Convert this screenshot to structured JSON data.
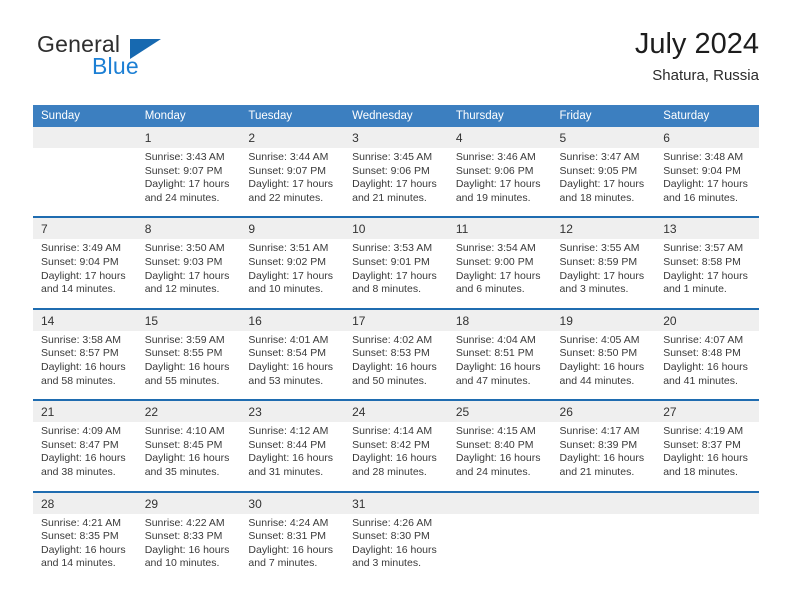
{
  "brand": {
    "name_part1": "General",
    "name_part2": "Blue",
    "triangle_color": "#1769b0",
    "blue_color": "#1c7fd4"
  },
  "header": {
    "title": "July 2024",
    "subtitle": "Shatura, Russia"
  },
  "theme": {
    "header_blue": "#3c7fc0",
    "row_divider_blue": "#1f6cb0",
    "daynum_band": "#efefef",
    "text": "#3a3a3a"
  },
  "weekdays": [
    "Sunday",
    "Monday",
    "Tuesday",
    "Wednesday",
    "Thursday",
    "Friday",
    "Saturday"
  ],
  "weeks": [
    {
      "days": [
        {
          "num": "",
          "sunrise": "",
          "sunset": "",
          "daylight1": "",
          "daylight2": ""
        },
        {
          "num": "1",
          "sunrise": "Sunrise: 3:43 AM",
          "sunset": "Sunset: 9:07 PM",
          "daylight1": "Daylight: 17 hours",
          "daylight2": "and 24 minutes."
        },
        {
          "num": "2",
          "sunrise": "Sunrise: 3:44 AM",
          "sunset": "Sunset: 9:07 PM",
          "daylight1": "Daylight: 17 hours",
          "daylight2": "and 22 minutes."
        },
        {
          "num": "3",
          "sunrise": "Sunrise: 3:45 AM",
          "sunset": "Sunset: 9:06 PM",
          "daylight1": "Daylight: 17 hours",
          "daylight2": "and 21 minutes."
        },
        {
          "num": "4",
          "sunrise": "Sunrise: 3:46 AM",
          "sunset": "Sunset: 9:06 PM",
          "daylight1": "Daylight: 17 hours",
          "daylight2": "and 19 minutes."
        },
        {
          "num": "5",
          "sunrise": "Sunrise: 3:47 AM",
          "sunset": "Sunset: 9:05 PM",
          "daylight1": "Daylight: 17 hours",
          "daylight2": "and 18 minutes."
        },
        {
          "num": "6",
          "sunrise": "Sunrise: 3:48 AM",
          "sunset": "Sunset: 9:04 PM",
          "daylight1": "Daylight: 17 hours",
          "daylight2": "and 16 minutes."
        }
      ]
    },
    {
      "days": [
        {
          "num": "7",
          "sunrise": "Sunrise: 3:49 AM",
          "sunset": "Sunset: 9:04 PM",
          "daylight1": "Daylight: 17 hours",
          "daylight2": "and 14 minutes."
        },
        {
          "num": "8",
          "sunrise": "Sunrise: 3:50 AM",
          "sunset": "Sunset: 9:03 PM",
          "daylight1": "Daylight: 17 hours",
          "daylight2": "and 12 minutes."
        },
        {
          "num": "9",
          "sunrise": "Sunrise: 3:51 AM",
          "sunset": "Sunset: 9:02 PM",
          "daylight1": "Daylight: 17 hours",
          "daylight2": "and 10 minutes."
        },
        {
          "num": "10",
          "sunrise": "Sunrise: 3:53 AM",
          "sunset": "Sunset: 9:01 PM",
          "daylight1": "Daylight: 17 hours",
          "daylight2": "and 8 minutes."
        },
        {
          "num": "11",
          "sunrise": "Sunrise: 3:54 AM",
          "sunset": "Sunset: 9:00 PM",
          "daylight1": "Daylight: 17 hours",
          "daylight2": "and 6 minutes."
        },
        {
          "num": "12",
          "sunrise": "Sunrise: 3:55 AM",
          "sunset": "Sunset: 8:59 PM",
          "daylight1": "Daylight: 17 hours",
          "daylight2": "and 3 minutes."
        },
        {
          "num": "13",
          "sunrise": "Sunrise: 3:57 AM",
          "sunset": "Sunset: 8:58 PM",
          "daylight1": "Daylight: 17 hours",
          "daylight2": "and 1 minute."
        }
      ]
    },
    {
      "days": [
        {
          "num": "14",
          "sunrise": "Sunrise: 3:58 AM",
          "sunset": "Sunset: 8:57 PM",
          "daylight1": "Daylight: 16 hours",
          "daylight2": "and 58 minutes."
        },
        {
          "num": "15",
          "sunrise": "Sunrise: 3:59 AM",
          "sunset": "Sunset: 8:55 PM",
          "daylight1": "Daylight: 16 hours",
          "daylight2": "and 55 minutes."
        },
        {
          "num": "16",
          "sunrise": "Sunrise: 4:01 AM",
          "sunset": "Sunset: 8:54 PM",
          "daylight1": "Daylight: 16 hours",
          "daylight2": "and 53 minutes."
        },
        {
          "num": "17",
          "sunrise": "Sunrise: 4:02 AM",
          "sunset": "Sunset: 8:53 PM",
          "daylight1": "Daylight: 16 hours",
          "daylight2": "and 50 minutes."
        },
        {
          "num": "18",
          "sunrise": "Sunrise: 4:04 AM",
          "sunset": "Sunset: 8:51 PM",
          "daylight1": "Daylight: 16 hours",
          "daylight2": "and 47 minutes."
        },
        {
          "num": "19",
          "sunrise": "Sunrise: 4:05 AM",
          "sunset": "Sunset: 8:50 PM",
          "daylight1": "Daylight: 16 hours",
          "daylight2": "and 44 minutes."
        },
        {
          "num": "20",
          "sunrise": "Sunrise: 4:07 AM",
          "sunset": "Sunset: 8:48 PM",
          "daylight1": "Daylight: 16 hours",
          "daylight2": "and 41 minutes."
        }
      ]
    },
    {
      "days": [
        {
          "num": "21",
          "sunrise": "Sunrise: 4:09 AM",
          "sunset": "Sunset: 8:47 PM",
          "daylight1": "Daylight: 16 hours",
          "daylight2": "and 38 minutes."
        },
        {
          "num": "22",
          "sunrise": "Sunrise: 4:10 AM",
          "sunset": "Sunset: 8:45 PM",
          "daylight1": "Daylight: 16 hours",
          "daylight2": "and 35 minutes."
        },
        {
          "num": "23",
          "sunrise": "Sunrise: 4:12 AM",
          "sunset": "Sunset: 8:44 PM",
          "daylight1": "Daylight: 16 hours",
          "daylight2": "and 31 minutes."
        },
        {
          "num": "24",
          "sunrise": "Sunrise: 4:14 AM",
          "sunset": "Sunset: 8:42 PM",
          "daylight1": "Daylight: 16 hours",
          "daylight2": "and 28 minutes."
        },
        {
          "num": "25",
          "sunrise": "Sunrise: 4:15 AM",
          "sunset": "Sunset: 8:40 PM",
          "daylight1": "Daylight: 16 hours",
          "daylight2": "and 24 minutes."
        },
        {
          "num": "26",
          "sunrise": "Sunrise: 4:17 AM",
          "sunset": "Sunset: 8:39 PM",
          "daylight1": "Daylight: 16 hours",
          "daylight2": "and 21 minutes."
        },
        {
          "num": "27",
          "sunrise": "Sunrise: 4:19 AM",
          "sunset": "Sunset: 8:37 PM",
          "daylight1": "Daylight: 16 hours",
          "daylight2": "and 18 minutes."
        }
      ]
    },
    {
      "days": [
        {
          "num": "28",
          "sunrise": "Sunrise: 4:21 AM",
          "sunset": "Sunset: 8:35 PM",
          "daylight1": "Daylight: 16 hours",
          "daylight2": "and 14 minutes."
        },
        {
          "num": "29",
          "sunrise": "Sunrise: 4:22 AM",
          "sunset": "Sunset: 8:33 PM",
          "daylight1": "Daylight: 16 hours",
          "daylight2": "and 10 minutes."
        },
        {
          "num": "30",
          "sunrise": "Sunrise: 4:24 AM",
          "sunset": "Sunset: 8:31 PM",
          "daylight1": "Daylight: 16 hours",
          "daylight2": "and 7 minutes."
        },
        {
          "num": "31",
          "sunrise": "Sunrise: 4:26 AM",
          "sunset": "Sunset: 8:30 PM",
          "daylight1": "Daylight: 16 hours",
          "daylight2": "and 3 minutes."
        },
        {
          "num": "",
          "sunrise": "",
          "sunset": "",
          "daylight1": "",
          "daylight2": ""
        },
        {
          "num": "",
          "sunrise": "",
          "sunset": "",
          "daylight1": "",
          "daylight2": ""
        },
        {
          "num": "",
          "sunrise": "",
          "sunset": "",
          "daylight1": "",
          "daylight2": ""
        }
      ]
    }
  ]
}
